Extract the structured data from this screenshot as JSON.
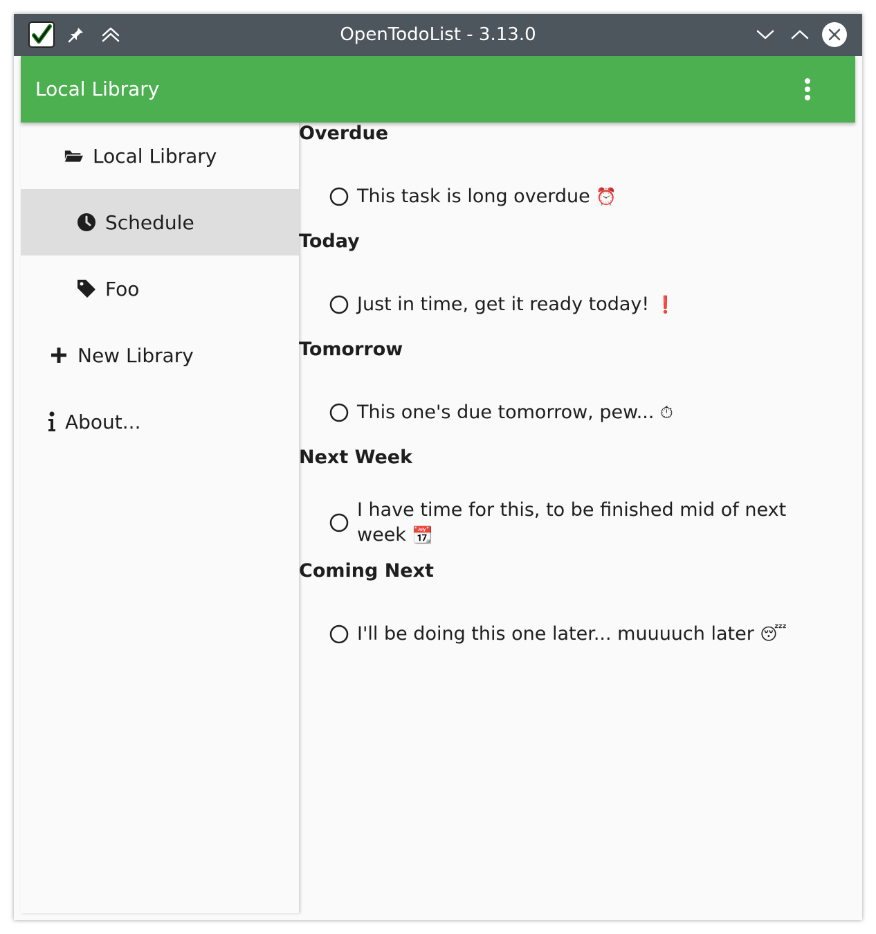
{
  "window": {
    "title": "OpenTodoList - 3.13.0"
  },
  "appbar": {
    "title": "Local Library"
  },
  "sidebar": {
    "items": [
      {
        "label": "Local Library",
        "icon": "folder-open-icon"
      },
      {
        "label": "Schedule",
        "icon": "clock-icon",
        "selected": true
      },
      {
        "label": "Foo",
        "icon": "tag-icon"
      },
      {
        "label": "New Library",
        "icon": "plus-icon"
      },
      {
        "label": "About...",
        "icon": "info-icon"
      }
    ]
  },
  "schedule": {
    "sections": [
      {
        "title": "Overdue",
        "tasks": [
          {
            "text": "This task is long overdue",
            "emoji": "⏰"
          }
        ]
      },
      {
        "title": "Today",
        "tasks": [
          {
            "text": "Just in time, get it ready today!",
            "emoji": "❗"
          }
        ]
      },
      {
        "title": "Tomorrow",
        "tasks": [
          {
            "text": "This one's due tomorrow, pew...",
            "emoji": "⏱"
          }
        ]
      },
      {
        "title": "Next Week",
        "tasks": [
          {
            "text": "I have time for this, to be finished mid of next week",
            "emoji": "📆"
          }
        ]
      },
      {
        "title": "Coming Next",
        "tasks": [
          {
            "text": "I'll be doing this one later... muuuuch later",
            "emoji": "😴"
          }
        ]
      }
    ]
  },
  "colors": {
    "titlebar": "#4d555d",
    "accent": "#4caf50",
    "selected_row": "#dedede",
    "background": "#fafafa",
    "text": "#1e1e1e"
  }
}
